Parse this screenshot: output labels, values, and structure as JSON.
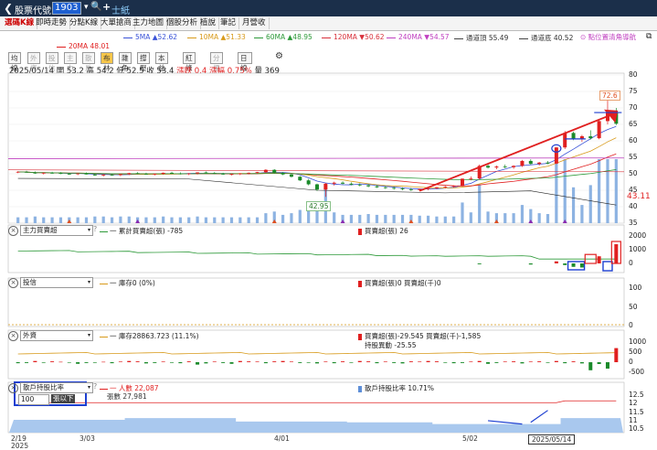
{
  "topbar": {
    "back": "❮",
    "label": "股票代號",
    "code": "1903",
    "dropdown": "▾",
    "name": "士紙"
  },
  "tabs": [
    {
      "label": "選碼K線",
      "active": true
    },
    {
      "label": "即時走勢",
      "active": false
    },
    {
      "label": "分點K線",
      "active": false
    },
    {
      "label": "大單搶商",
      "active": false
    },
    {
      "label": "主力地圖",
      "active": false
    },
    {
      "label": "個股分析",
      "active": false
    },
    {
      "label": "植說",
      "active": false
    },
    {
      "label": "筆記",
      "active": false
    },
    {
      "label": "月營收",
      "active": false
    }
  ],
  "ma_legend": [
    {
      "text": "5MA ▲52.62",
      "color": "#3a53d8"
    },
    {
      "text": "10MA ▲51.33",
      "color": "#d89a1a"
    },
    {
      "text": "60MA ▲48.95",
      "color": "#2e9a3a"
    },
    {
      "text": "120MA ▼50.62",
      "color": "#d8303a"
    },
    {
      "text": "240MA ▼54.57",
      "color": "#c040c0"
    },
    {
      "text": "通道頂 55.49",
      "color": "#444444"
    },
    {
      "text": "通道底 40.52",
      "color": "#444444"
    },
    {
      "text": "20MA 48.01",
      "color": "#e02020"
    }
  ],
  "settings_link": "⊙ 點位置清角導航",
  "subbuttons": [
    {
      "label": "均線",
      "state": "normal"
    },
    {
      "label": "外資",
      "state": "dis"
    },
    {
      "label": "投信",
      "state": "dis"
    },
    {
      "label": "主力",
      "state": "dis"
    },
    {
      "label": "散戶",
      "state": "dis"
    },
    {
      "label": "布林",
      "state": "on"
    },
    {
      "label": "雜角",
      "state": "normal"
    },
    {
      "label": "撐壓",
      "state": "normal"
    },
    {
      "label": "本益比",
      "state": "normal"
    },
    {
      "label": "紅綠燈",
      "state": "normal"
    },
    {
      "label": "分價線",
      "state": "dis"
    },
    {
      "label": "日線(週期)",
      "state": "normal"
    },
    {
      "label": "⚙",
      "state": "gear"
    }
  ],
  "info": {
    "date": "2025/05/14",
    "open": "開 53.2",
    "high": "高 54.2",
    "low": "低 52.5",
    "close": "收 53.4",
    "chg": "漲跌 0.4",
    "pct": "漲幅 0.75%",
    "vol": "量 369"
  },
  "price_axis": [
    "80",
    "75",
    "70",
    "65",
    "60",
    "55",
    "50",
    "45",
    "40",
    "35"
  ],
  "last_price": "43.11",
  "callout_high": "72.6",
  "callout_low": "42.95",
  "panels": {
    "p1": {
      "select": "主力買賣超",
      "legend_a": "一 累計買賣超(張) -785",
      "legend_b": "買賣超(張) 26",
      "axis": [
        "2000",
        "1000",
        "0"
      ]
    },
    "p2": {
      "select": "投信",
      "legend_a": "一 庫存0 (0%)",
      "legend_b": "買賣超(張)0 買賣超(千)0",
      "axis": [
        "100",
        "50",
        "0"
      ]
    },
    "p3": {
      "select": "外資",
      "legend_a": "一 庫存28863.723 (11.1%)",
      "legend_b": "買賣超(張)-29.545 買賣超(千)-1,585",
      "legend_c": "持股異動 -25.55",
      "axis": [
        "1000",
        "500",
        "0",
        "-500"
      ]
    },
    "p4": {
      "select": "散戶持股比率",
      "legend_a": "一 人數 22,087",
      "legend_a2": "張數 27,981",
      "legend_b": "散戶持股比率 10.71%",
      "sub_select": "100",
      "sub_unit": "張以下",
      "axis": [
        "12.5",
        "12",
        "11.5",
        "11",
        "10.5"
      ]
    }
  },
  "x_axis": [
    {
      "label": "2/19",
      "sub": "2025"
    },
    {
      "label": "3/03",
      "sub": ""
    },
    {
      "label": "4/01",
      "sub": ""
    },
    {
      "label": "5/02",
      "sub": ""
    },
    {
      "label": "2025/05/14",
      "sub": ""
    }
  ],
  "colors": {
    "up": "#e02020",
    "down": "#1a8a2a",
    "accent": "#1d5fd1",
    "header": "#1b2f4a"
  },
  "chart_data": {
    "type": "candlestick",
    "ylim": [
      35,
      80
    ],
    "candles": [
      [
        50.5,
        50.8,
        50.2,
        50.6
      ],
      [
        50.6,
        50.9,
        50.3,
        50.4
      ],
      [
        50.4,
        50.7,
        50.0,
        50.1
      ],
      [
        50.1,
        50.4,
        49.8,
        50.3
      ],
      [
        50.3,
        50.6,
        50.0,
        50.2
      ],
      [
        50.2,
        50.5,
        49.9,
        50.0
      ],
      [
        50.0,
        50.3,
        49.7,
        49.9
      ],
      [
        49.9,
        50.2,
        49.6,
        50.1
      ],
      [
        50.1,
        50.4,
        49.8,
        49.8
      ],
      [
        49.8,
        50.1,
        49.4,
        49.5
      ],
      [
        49.5,
        49.9,
        49.2,
        49.7
      ],
      [
        49.7,
        50.0,
        49.4,
        49.6
      ],
      [
        49.6,
        50.0,
        49.3,
        49.9
      ],
      [
        49.9,
        50.3,
        49.6,
        50.2
      ],
      [
        50.2,
        50.5,
        49.9,
        50.0
      ],
      [
        50.0,
        50.3,
        49.7,
        49.8
      ],
      [
        49.8,
        50.1,
        49.5,
        50.0
      ],
      [
        50.0,
        50.4,
        49.7,
        50.3
      ],
      [
        50.3,
        50.6,
        50.0,
        50.1
      ],
      [
        50.1,
        50.4,
        49.8,
        49.9
      ],
      [
        49.9,
        50.2,
        49.6,
        50.1
      ],
      [
        50.1,
        50.5,
        49.8,
        50.4
      ],
      [
        50.4,
        50.7,
        50.1,
        50.2
      ],
      [
        50.2,
        50.5,
        49.9,
        50.0
      ],
      [
        50.0,
        50.3,
        49.7,
        49.8
      ],
      [
        49.8,
        50.1,
        49.5,
        49.9
      ],
      [
        49.9,
        50.2,
        49.6,
        50.1
      ],
      [
        50.1,
        50.4,
        49.8,
        50.3
      ],
      [
        50.3,
        50.6,
        50.0,
        50.5
      ],
      [
        50.5,
        51.4,
        50.3,
        51.2
      ],
      [
        51.2,
        51.4,
        50.1,
        50.3
      ],
      [
        50.3,
        50.5,
        49.6,
        49.8
      ],
      [
        49.8,
        50.0,
        48.9,
        49.1
      ],
      [
        49.1,
        49.3,
        47.8,
        48.0
      ],
      [
        48.0,
        48.4,
        46.5,
        46.8
      ],
      [
        46.8,
        47.0,
        44.8,
        45.2
      ],
      [
        45.2,
        47.2,
        43.0,
        47.0
      ],
      [
        47.0,
        47.6,
        46.4,
        47.3
      ],
      [
        47.3,
        47.7,
        46.8,
        47.0
      ],
      [
        47.0,
        47.4,
        46.5,
        46.7
      ],
      [
        46.7,
        47.1,
        46.2,
        46.5
      ],
      [
        46.5,
        46.9,
        45.9,
        46.2
      ],
      [
        46.2,
        46.6,
        45.7,
        45.9
      ],
      [
        45.9,
        46.3,
        45.4,
        45.7
      ],
      [
        45.7,
        46.1,
        45.2,
        45.5
      ],
      [
        45.5,
        45.9,
        45.0,
        45.3
      ],
      [
        45.3,
        45.7,
        44.8,
        45.1
      ],
      [
        45.1,
        45.5,
        44.7,
        45.4
      ],
      [
        45.4,
        45.8,
        45.0,
        45.6
      ],
      [
        45.6,
        46.0,
        45.3,
        45.9
      ],
      [
        45.9,
        46.3,
        45.6,
        46.1
      ],
      [
        46.1,
        46.5,
        45.8,
        46.4
      ],
      [
        46.4,
        48.6,
        46.2,
        48.5
      ],
      [
        48.5,
        49.2,
        48.0,
        48.6
      ],
      [
        48.6,
        52.8,
        48.2,
        52.4
      ],
      [
        52.4,
        52.9,
        51.6,
        51.9
      ],
      [
        51.9,
        52.5,
        51.4,
        52.2
      ],
      [
        52.2,
        52.8,
        51.7,
        52.0
      ],
      [
        52.0,
        52.6,
        51.5,
        52.4
      ],
      [
        52.4,
        54.2,
        52.1,
        53.9
      ],
      [
        53.9,
        54.4,
        52.8,
        53.0
      ],
      [
        53.0,
        53.6,
        52.5,
        53.4
      ],
      [
        53.4,
        53.9,
        52.9,
        53.1
      ],
      [
        53.1,
        58.1,
        52.9,
        58.0
      ],
      [
        58.0,
        63.0,
        57.5,
        62.4
      ],
      [
        62.4,
        62.8,
        60.2,
        60.5
      ],
      [
        60.5,
        61.8,
        59.7,
        61.4
      ],
      [
        61.4,
        63.2,
        60.4,
        60.8
      ],
      [
        60.8,
        66.5,
        60.5,
        66.0
      ],
      [
        66.0,
        72.6,
        65.0,
        68.5
      ],
      [
        68.5,
        70.0,
        64.8,
        65.2
      ]
    ],
    "volume_axis_max": 5000,
    "p1_bars": [
      0,
      0,
      0,
      0,
      0,
      0,
      0,
      0,
      0,
      0,
      0,
      0,
      0,
      0,
      0,
      0,
      0,
      0,
      0,
      0,
      0,
      0,
      0,
      0,
      0,
      0,
      0,
      0,
      0,
      0,
      0,
      0,
      0,
      0,
      0,
      0,
      0,
      0,
      0,
      0,
      0,
      0,
      0,
      0,
      0,
      0,
      0,
      0,
      0,
      0,
      0,
      0,
      0,
      0,
      -60,
      0,
      0,
      0,
      0,
      0,
      -80,
      0,
      0,
      150,
      -120,
      -250,
      -300,
      0,
      520,
      0,
      1400
    ],
    "p3_bars": [
      -50,
      -40,
      60,
      -30,
      40,
      20,
      -20,
      -80,
      -40,
      -30,
      20,
      -50,
      30,
      60,
      40,
      -60,
      -40,
      30,
      -30,
      -50,
      40,
      -120,
      -60,
      30,
      -40,
      -80,
      60,
      40,
      30,
      -50,
      40,
      60,
      30,
      -40,
      -30,
      -60,
      30,
      -50,
      40,
      -30,
      60,
      40,
      -50,
      30,
      -40,
      -60,
      40,
      30,
      60,
      40,
      -30,
      -50,
      -40,
      30,
      60,
      -80,
      -40,
      30,
      40,
      -60,
      30,
      40,
      -30,
      60,
      -50,
      40,
      -60,
      -400,
      -90,
      -320,
      700
    ]
  }
}
